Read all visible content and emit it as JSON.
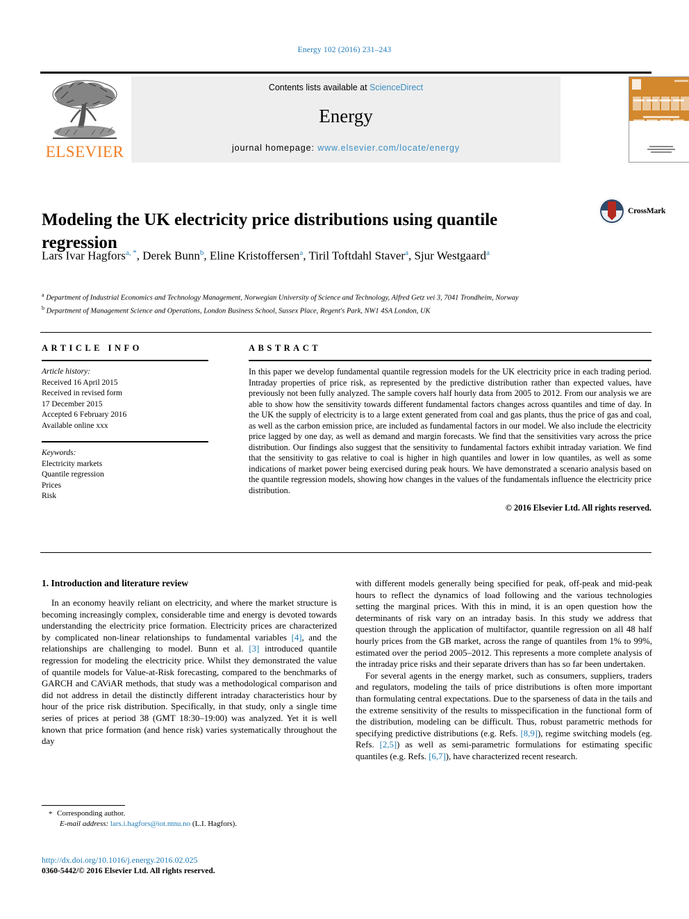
{
  "running_head": "Energy 102 (2016) 231–243",
  "journal_header": {
    "contents_prefix": "Contents lists available at ",
    "contents_link": "ScienceDirect",
    "journal_name": "Energy",
    "homepage_prefix": "journal homepage: ",
    "homepage_url": "www.elsevier.com/locate/energy",
    "publisher": "ELSEVIER",
    "cover_title": "ENERGY",
    "logo_icon": "elsevier-tree-logo"
  },
  "article": {
    "title": "Modeling the UK electricity price distributions using quantile regression",
    "crossmark_label": "CrossMark",
    "authors_line1": "Lars Ivar Hagfors",
    "authors": [
      {
        "name": "Lars Ivar Hagfors",
        "marks": "a, *"
      },
      {
        "name": "Derek Bunn",
        "marks": "b"
      },
      {
        "name": "Eline Kristoffersen",
        "marks": "a"
      },
      {
        "name": "Tiril Toftdahl Staver",
        "marks": "a"
      },
      {
        "name": "Sjur Westgaard",
        "marks": "a"
      }
    ],
    "affiliations": [
      {
        "mark": "a",
        "text": "Department of Industrial Economics and Technology Management, Norwegian University of Science and Technology, Alfred Getz vei 3, 7041 Trondheim, Norway"
      },
      {
        "mark": "b",
        "text": "Department of Management Science and Operations, London Business School, Sussex Place, Regent's Park, NW1 4SA London, UK"
      }
    ]
  },
  "article_info": {
    "heading": "ARTICLE INFO",
    "history_label": "Article history:",
    "history": [
      "Received 16 April 2015",
      "Received in revised form",
      "17 December 2015",
      "Accepted 6 February 2016",
      "Available online xxx"
    ],
    "keywords_label": "Keywords:",
    "keywords": [
      "Electricity markets",
      "Quantile regression",
      "Prices",
      "Risk"
    ]
  },
  "abstract": {
    "heading": "ABSTRACT",
    "text": "In this paper we develop fundamental quantile regression models for the UK electricity price in each trading period. Intraday properties of price risk, as represented by the predictive distribution rather than expected values, have previously not been fully analyzed. The sample covers half hourly data from 2005 to 2012. From our analysis we are able to show how the sensitivity towards different fundamental factors changes across quantiles and time of day. In the UK the supply of electricity is to a large extent generated from coal and gas plants, thus the price of gas and coal, as well as the carbon emission price, are included as fundamental factors in our model. We also include the electricity price lagged by one day, as well as demand and margin forecasts. We find that the sensitivities vary across the price distribution. Our findings also suggest that the sensitivity to fundamental factors exhibit intraday variation. We find that the sensitivity to gas relative to coal is higher in high quantiles and lower in low quantiles, as well as some indications of market power being exercised during peak hours. We have demonstrated a scenario analysis based on the quantile regression models, showing how changes in the values of the fundamentals influence the electricity price distribution.",
    "copyright": "© 2016 Elsevier Ltd. All rights reserved."
  },
  "body": {
    "section_title": "1. Introduction and literature review",
    "left_p1_a": "In an economy heavily reliant on electricity, and where the market structure is becoming increasingly complex, considerable time and energy is devoted towards understanding the electricity price formation. Electricity prices are characterized by complicated non-linear relationships to fundamental variables ",
    "ref_4": "[4]",
    "left_p1_b": ", and the relationships are challenging to model. Bunn et al. ",
    "ref_3": "[3]",
    "left_p1_c": " introduced quantile regression for modeling the electricity price. Whilst they demonstrated the value of quantile models for Value-at-Risk forecasting, compared to the benchmarks of GARCH and CAViAR methods, that study was a methodological comparison and did not address in detail the distinctly different intraday characteristics hour by hour of the price risk distribution. Specifically, in that study, only a single time series of prices at period 38 (GMT 18:30–19:00) was analyzed. Yet it is well known that price formation (and hence risk) varies systematically throughout the day",
    "right_p1": "with different models generally being specified for peak, off-peak and mid-peak hours to reflect the dynamics of load following and the various technologies setting the marginal prices. With this in mind, it is an open question how the determinants of risk vary on an intraday basis. In this study we address that question through the application of multifactor, quantile regression on all 48 half hourly prices from the GB market, across the range of quantiles from 1% to 99%, estimated over the period 2005–2012. This represents a more complete analysis of the intraday price risks and their separate drivers than has so far been undertaken.",
    "right_p2_a": "For several agents in the energy market, such as consumers, suppliers, traders and regulators, modeling the tails of price distributions is often more important than formulating central expectations. Due to the sparseness of data in the tails and the extreme sensitivity of the results to misspecification in the functional form of the distribution, modeling can be difficult. Thus, robust parametric methods for specifying predictive distributions (e.g. Refs. ",
    "ref_89": "[8,9]",
    "right_p2_b": "), regime switching models (eg. Refs. ",
    "ref_25": "[2,5]",
    "right_p2_c": ") as well as semi-parametric formulations for estimating specific quantiles (e.g. Refs. ",
    "ref_67": "[6,7]",
    "right_p2_d": "), have characterized recent research."
  },
  "footnote": {
    "star": "*",
    "corresponding": "Corresponding author.",
    "email_label": "E-mail address:",
    "email": "lars.i.hagfors@iot.ntnu.no",
    "email_suffix": " (L.I. Hagfors)."
  },
  "footer": {
    "doi": "http://dx.doi.org/10.1016/j.energy.2016.02.025",
    "issn": "0360-5442/© 2016 Elsevier Ltd. All rights reserved."
  },
  "colors": {
    "link_blue": "#1f7bb6",
    "elsevier_orange": "#ef7d22",
    "band_grey": "#eeeeee",
    "cover_orange": "#d3882e"
  }
}
